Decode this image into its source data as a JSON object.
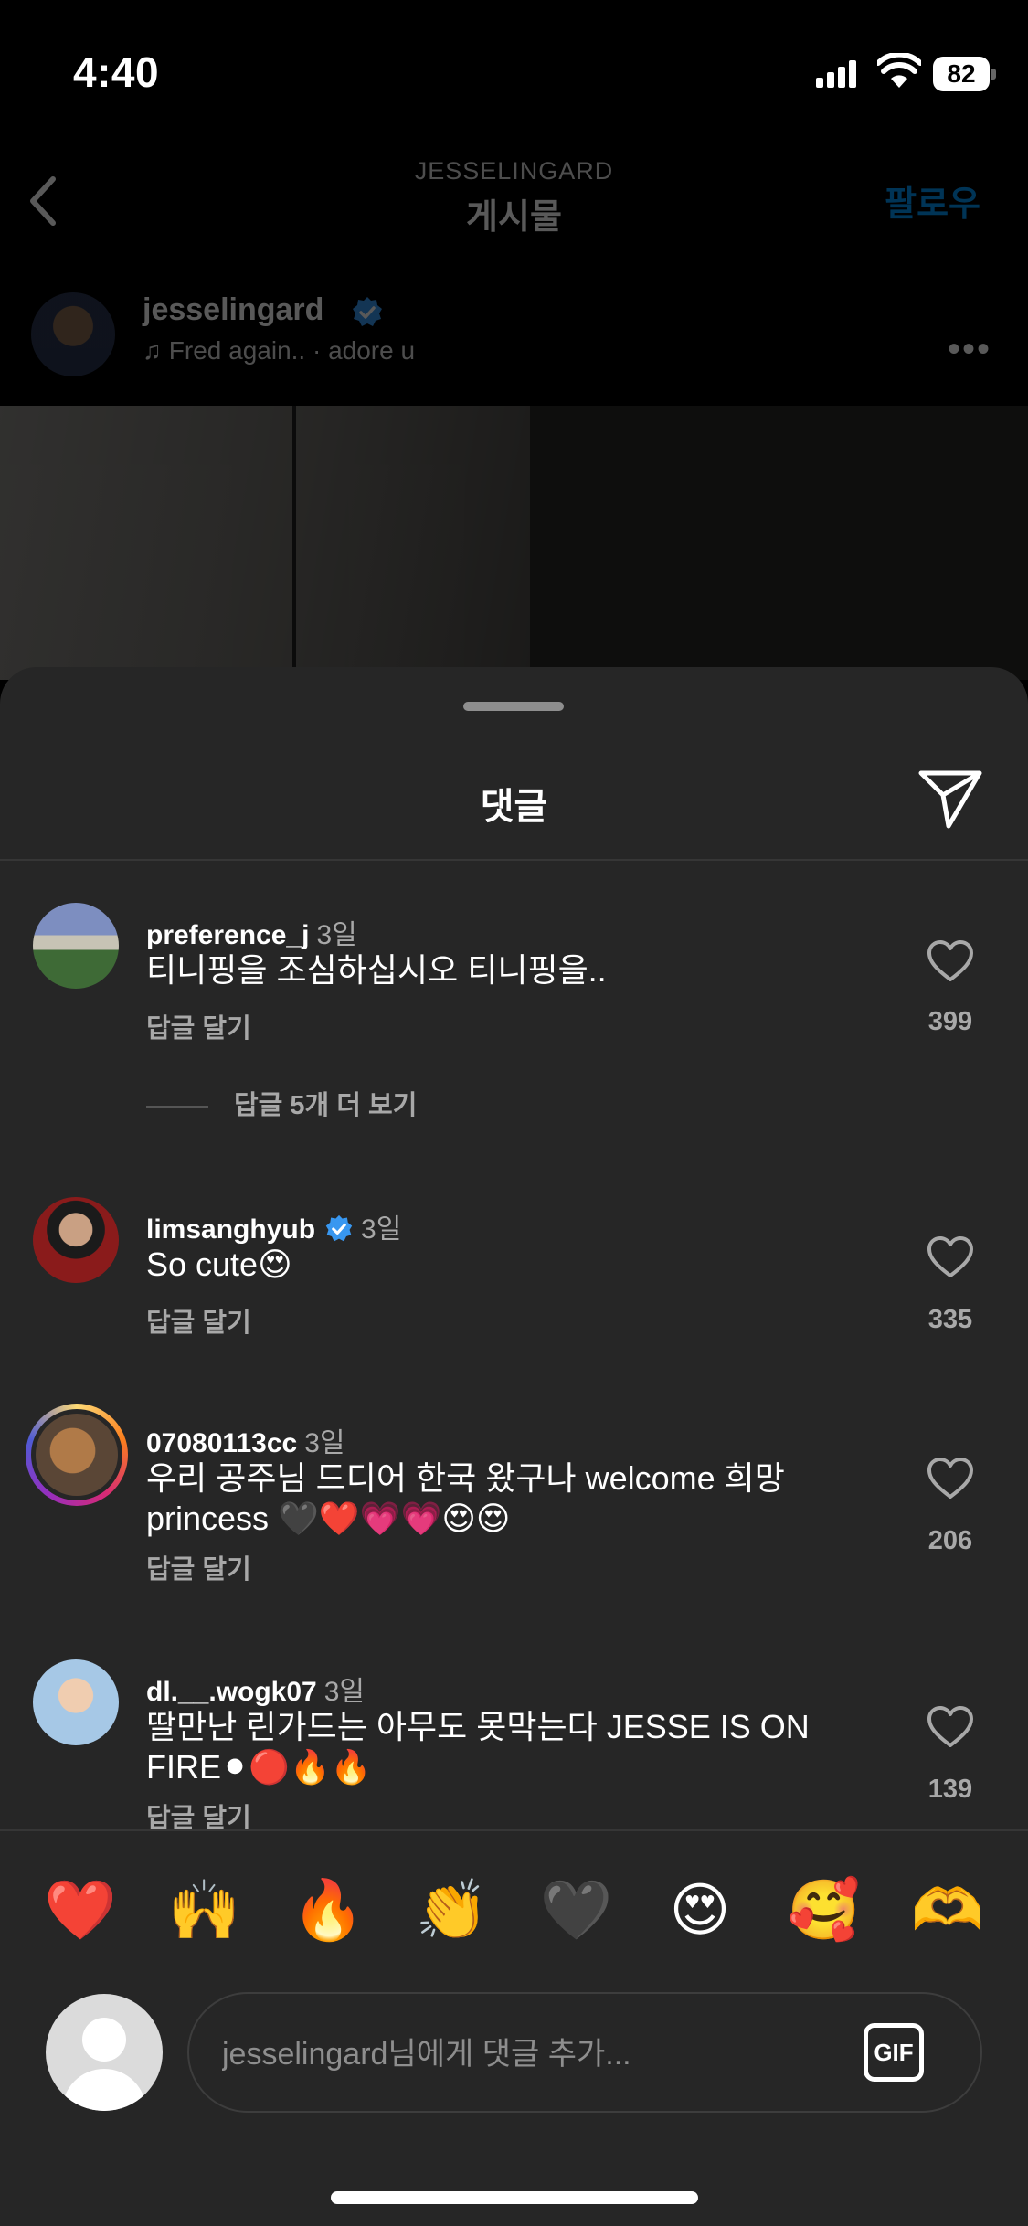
{
  "status_bar": {
    "time": "4:40",
    "battery": "82",
    "icons": [
      "signal-icon",
      "wifi-icon",
      "battery-icon"
    ]
  },
  "nav": {
    "subtitle": "JESSELINGARD",
    "title": "게시물",
    "follow_label": "팔로우",
    "back_icon": "chevron-left-icon"
  },
  "post": {
    "username": "jesselingard",
    "verified": true,
    "music": "Fred again.. · adore u",
    "more_icon": "more-horizontal-icon"
  },
  "sheet": {
    "title": "댓글",
    "share_icon": "paper-plane-icon"
  },
  "comments": [
    {
      "username": "preference_j",
      "verified": false,
      "time": "3일",
      "text": "티니핑을 조심하십시오 티니핑을..",
      "reply_label": "답글 달기",
      "likes": "399",
      "more_replies": "답글 5개 더 보기"
    },
    {
      "username": "limsanghyub",
      "verified": true,
      "time": "3일",
      "text": "So cute😍",
      "reply_label": "답글 달기",
      "likes": "335"
    },
    {
      "username": "07080113cc",
      "verified": false,
      "time": "3일",
      "text": "우리 공주님 드디어 한국 왔구나 welcome 희망 princess 🖤❤️💗💗😍😍",
      "reply_label": "답글 달기",
      "likes": "206"
    },
    {
      "username": "dl.__.wogk07",
      "verified": false,
      "time": "3일",
      "text": "딸만난 린가드는 아무도 못막는다 JESSE IS ON FIRE⚫🔴🔥🔥",
      "reply_label": "답글 달기",
      "likes": "139"
    }
  ],
  "emoji_bar": [
    "❤️",
    "🙌",
    "🔥",
    "👏",
    "🖤",
    "😍",
    "🥰",
    "🫶"
  ],
  "composer": {
    "placeholder": "jesselingard님에게 댓글 추가...",
    "gif_label": "GIF"
  },
  "colors": {
    "sheet_bg": "#262626",
    "accent": "#0095f6",
    "verified": "#3897f0",
    "muted_text": "#a8a8a8"
  }
}
